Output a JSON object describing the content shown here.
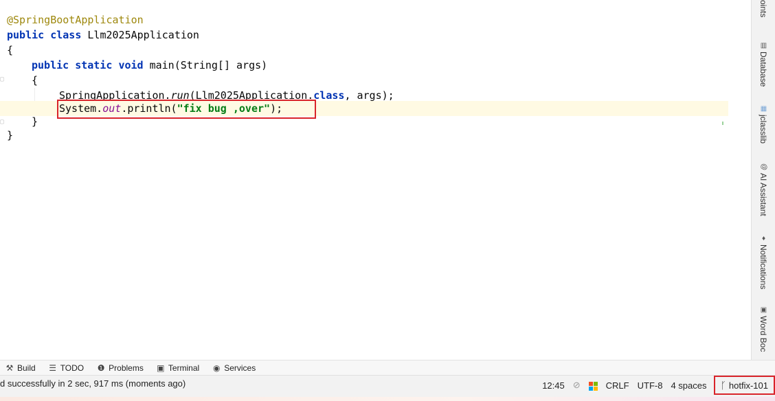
{
  "editor": {
    "lines": [
      {
        "annotation": "@SpringBootApplication"
      },
      {
        "kw1": "public",
        "kw2": "class",
        "name": "Llm2025Application"
      },
      {
        "text": "{"
      },
      {
        "kw1": "public",
        "kw2": "static",
        "kw3": "void",
        "rest": "main(String[] args)"
      },
      {
        "text": "{"
      },
      {
        "obj": "SpringApplication.",
        "method": "run",
        "args1": "(Llm2025Application.",
        "kw": "class",
        "args2": ", args);"
      },
      {
        "obj": "System.",
        "field": "out",
        "call": ".println(",
        "str": "\"fix bug ,over\"",
        "end": ");"
      },
      {
        "text": "}"
      },
      {
        "text": "}"
      }
    ]
  },
  "side_panel": {
    "items": [
      {
        "label": "oints",
        "icon": "breakpoints-icon"
      },
      {
        "label": "Database",
        "icon": "database-icon",
        "glyph": "▥"
      },
      {
        "label": "jclasslib",
        "icon": "jclasslib-icon",
        "glyph": "▦"
      },
      {
        "label": "AI Assistant",
        "icon": "ai-assistant-icon",
        "glyph": "@"
      },
      {
        "label": "Notifications",
        "icon": "bell-icon",
        "glyph": "♦"
      },
      {
        "label": "Word Boc",
        "icon": "word-book-icon",
        "glyph": "▣"
      }
    ]
  },
  "toolbar": {
    "items": [
      {
        "label": "Build",
        "icon": "hammer-icon",
        "glyph": "⚒"
      },
      {
        "label": "TODO",
        "icon": "list-icon",
        "glyph": "☰"
      },
      {
        "label": "Problems",
        "icon": "problems-icon",
        "glyph": "❶"
      },
      {
        "label": "Terminal",
        "icon": "terminal-icon",
        "glyph": "▣"
      },
      {
        "label": "Services",
        "icon": "services-icon",
        "glyph": "◉"
      }
    ]
  },
  "status": {
    "message": "d successfully in 2 sec, 917 ms (moments ago)",
    "position": "12:45",
    "line_separator": "CRLF",
    "encoding": "UTF-8",
    "indent": "4 spaces",
    "branch": "hotfix-101",
    "colors": {
      "highlight_box": "#d9232a",
      "current_line": "#fffae3",
      "keyword": "#0033b3",
      "string": "#067d17",
      "annotation": "#9e880d",
      "field": "#871094"
    }
  }
}
